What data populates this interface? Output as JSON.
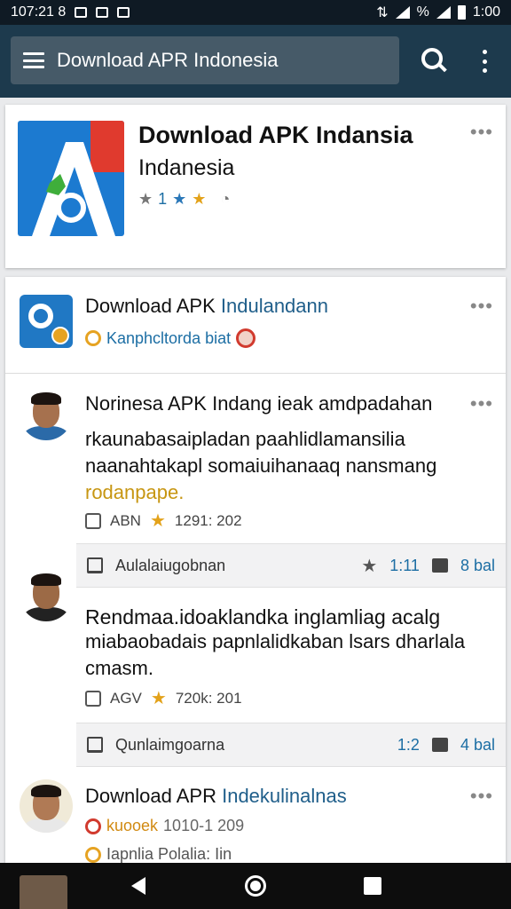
{
  "status_bar": {
    "left_text": "107:21 8",
    "percent": "%",
    "time": "1:00"
  },
  "app_bar": {
    "search_text": "Download APR Indonesia"
  },
  "top_card": {
    "title": "Download APK Indansia",
    "subtitle": "Indanesia",
    "rating_value": "1",
    "more": "•••"
  },
  "feed": {
    "header": {
      "title_main": "Download APK ",
      "title_accent": "Indulandann",
      "meta": "Kanphcltorda biat",
      "more": "•••"
    },
    "posts": [
      {
        "title": "Norinesa APK Indang ieak amdpadahan",
        "body_line1": "rkaunabasaipladan paahlidlamansilia",
        "body_line2": "naanahtakapl somaiuihanaaq nansmang",
        "body_line3": "rodanpape.",
        "likes": "ABN",
        "rating_text": "1291: 202",
        "action_label": "Aulalaiugobnan",
        "action_stars": "1:11",
        "comments": "8 bal",
        "more": "•••"
      },
      {
        "title": "Rendmaa.idoaklandka inglamliag acalg",
        "body_line1": "miabaobadais papnlalidkaban lsars dharlala",
        "body_line2": "cmasm.",
        "likes": "AGV",
        "rating_text": "720k: 201",
        "action_label": "Qunlaimgoarna",
        "action_stars": "1:2",
        "comments": "4 bal"
      },
      {
        "title_main": "Download APR ",
        "title_accent": "Indekulinalnas",
        "meta_accent": "kuooek",
        "meta_text": "1010-1 209",
        "meta2": "Iapnlia Polalia: Iin",
        "more": "•••"
      }
    ]
  },
  "colors": {
    "app_bar": "#1d3a4d",
    "accent_blue": "#1c6ea4",
    "star": "#e3a21a"
  }
}
